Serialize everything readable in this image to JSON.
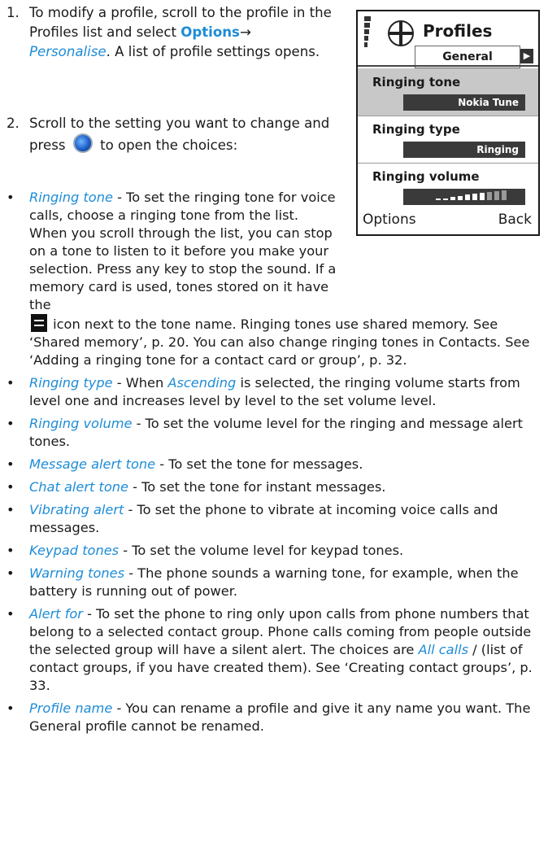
{
  "step1": {
    "num": "1.",
    "a": "To modify a profile, scroll to the profile in the Profiles list and select ",
    "options": "Options",
    "arrow": "→",
    "personalise": "Personalise",
    "b": ". A list of profile settings opens."
  },
  "step2": {
    "num": "2.",
    "a": "Scroll to the setting you want to change and press",
    "b": "to open the choices:"
  },
  "phone": {
    "title": "Profiles",
    "tab": "General",
    "items": [
      {
        "label": "Ringing tone",
        "value": "Nokia Tune"
      },
      {
        "label": "Ringing type",
        "value": "Ringing"
      },
      {
        "label": "Ringing volume",
        "value": ""
      }
    ],
    "left_soft": "Options",
    "right_soft": "Back"
  },
  "bullets": [
    {
      "term": "Ringing tone",
      "text": " - To set the ringing tone for voice calls, choose a ringing tone from the list. When you scroll through the list, you can stop on a tone to listen to it before you make your selection. Press any key to stop the sound. If a memory card is used, tones stored on it have the ",
      "text2": " icon next to the tone name. Ringing tones use shared memory. See ‘Shared memory’, p. 20.  You can also change ringing tones in Contacts. See ‘Adding a ringing tone for a contact card or group’, p. 32."
    },
    {
      "term": "Ringing type",
      "text": " - When ",
      "term2": "Ascending",
      "text2": " is selected, the ringing volume starts from level one and increases level by level to the set volume level."
    },
    {
      "term": "Ringing volume",
      "text": " - To set the volume level for the ringing and message alert tones."
    },
    {
      "term": "Message alert tone",
      "text": " - To set the tone for messages."
    },
    {
      "term": "Chat alert tone",
      "text": " - To set the tone for instant messages."
    },
    {
      "term": "Vibrating alert",
      "text": " - To set the phone to vibrate at incoming voice calls and messages."
    },
    {
      "term": "Keypad tones",
      "text": " - To set the volume level for keypad tones."
    },
    {
      "term": "Warning tones",
      "text": " - The phone sounds a warning tone, for example, when the battery is running out of power."
    },
    {
      "term": "Alert for",
      "text": " - To set the phone to ring only upon calls from phone numbers that belong to a selected contact group. Phone calls coming from people outside the selected group will have a silent alert. The choices are ",
      "term2": "All calls",
      "text2": " / (list of contact groups, if you have created them). See ‘Creating contact groups’, p. 33."
    },
    {
      "term": "Profile name",
      "text": " - You can rename a profile and give it any name you want. The General profile cannot be renamed."
    }
  ],
  "bullet_char": "•"
}
